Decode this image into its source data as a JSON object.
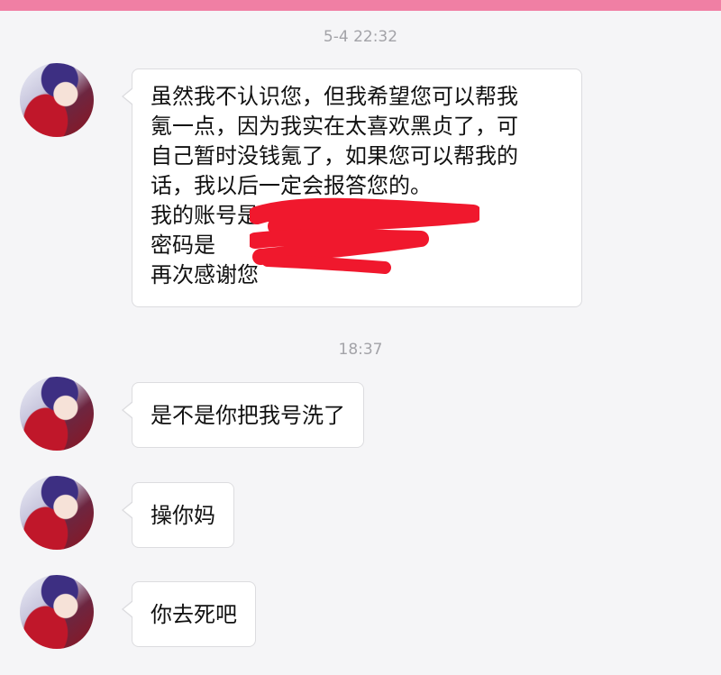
{
  "chat": {
    "timestamps": [
      "5-4 22:32",
      "18:37"
    ],
    "messages": [
      {
        "lines": [
          "虽然我不认识您，但我希望您可以帮我",
          "氪一点，因为我实在太喜欢黑贞了，可",
          "自己暂时没钱氪了，如果您可以帮我的",
          "话，我以后一定会报答您的。",
          "我的账号是",
          "密码是",
          "再次感谢您"
        ]
      },
      {
        "text": "是不是你把我号洗了"
      },
      {
        "text": "操你妈"
      },
      {
        "text": "你去死吧"
      }
    ]
  },
  "colors": {
    "accent_strip": "#f07fa4",
    "background": "#f5f5f7",
    "bubble": "#ffffff",
    "timestamp": "#a3a3a8",
    "redaction": "#f0182d"
  },
  "icons": {
    "avatar": "anime-character-avatar"
  }
}
